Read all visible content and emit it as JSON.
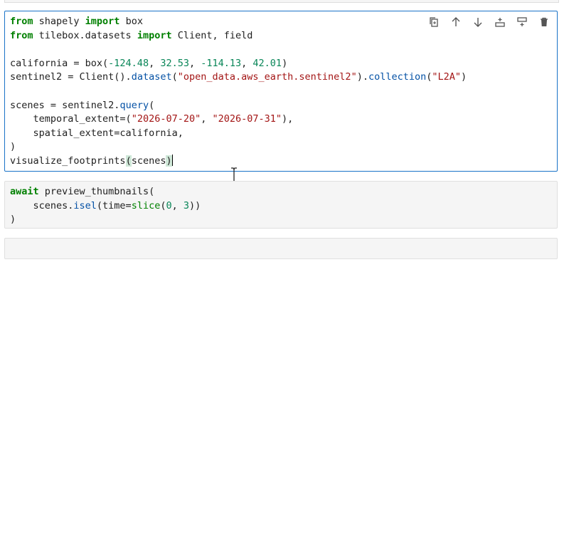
{
  "toolbar": {
    "copy": "duplicate-cell",
    "up": "move-cell-up",
    "down": "move-cell-down",
    "insert_above": "insert-cell-above",
    "insert_below": "insert-cell-below",
    "delete": "delete-cell"
  },
  "cell1": {
    "l1": [
      "from",
      " shapely ",
      "import",
      " box"
    ],
    "l2": [
      "from",
      " tilebox.datasets ",
      "import",
      " Client, field"
    ],
    "l4": [
      "california = box(",
      "-124.48",
      ", ",
      "32.53",
      ", ",
      "-114.13",
      ", ",
      "42.01",
      ")"
    ],
    "l5": [
      "sentinel2 = Client().",
      "dataset",
      "(",
      "\"open_data.aws_earth.sentinel2\"",
      ").",
      "collection",
      "(",
      "\"L2A\"",
      ")"
    ],
    "l7": [
      "scenes = sentinel2.",
      "query",
      "("
    ],
    "l8": [
      "    temporal_extent=(",
      "\"2026-07-20\"",
      ", ",
      "\"2026-07-31\"",
      "),"
    ],
    "l9": [
      "    spatial_extent=california,"
    ],
    "l10": [
      ")"
    ],
    "l11": [
      "visualize_footprints",
      "(",
      "scenes",
      ")"
    ]
  },
  "cell2": {
    "l1": [
      "await",
      " preview_thumbnails("
    ],
    "l2": [
      "    scenes.",
      "isel",
      "(time=",
      "slice",
      "(",
      "0",
      ", ",
      "3",
      "))"
    ],
    "l3": [
      ")"
    ]
  }
}
